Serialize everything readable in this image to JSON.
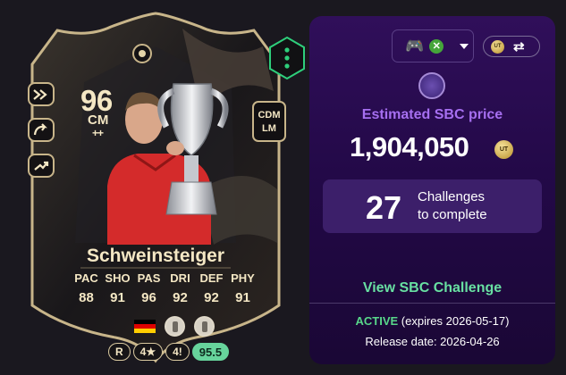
{
  "card": {
    "rating": "96",
    "position": "CM",
    "position_plus": "++",
    "alt_positions": [
      "CDM",
      "LM"
    ],
    "name": "Schweinsteiger",
    "stats": [
      {
        "label": "PAC",
        "value": "88"
      },
      {
        "label": "SHO",
        "value": "91"
      },
      {
        "label": "PAS",
        "value": "96"
      },
      {
        "label": "DRI",
        "value": "92"
      },
      {
        "label": "DEF",
        "value": "92"
      },
      {
        "label": "PHY",
        "value": "91"
      }
    ],
    "preferred_foot": "R",
    "skill_moves": "4★",
    "weak_foot": "4!",
    "score": "95.5",
    "colors": {
      "gold": "#c8b58a",
      "text": "#f4e7c4",
      "score": "#67d49c",
      "menu": "#2ecf7b"
    }
  },
  "panel": {
    "platform_icons": [
      "playstation-icon",
      "xbox-icon"
    ],
    "estimated_label": "Estimated SBC price",
    "price": "1,904,050",
    "coin_label": "UT",
    "challenges_count": "27",
    "challenges_text_1": "Challenges",
    "challenges_text_2": "to complete",
    "view_link": "View SBC Challenge",
    "status": "ACTIVE",
    "expires": "(expires 2026-05-17)",
    "release": "Release date: 2026-04-26",
    "colors": {
      "accent": "#a66ff0",
      "link": "#68e0a2",
      "active": "#58d78a",
      "bg": "#230948"
    }
  }
}
